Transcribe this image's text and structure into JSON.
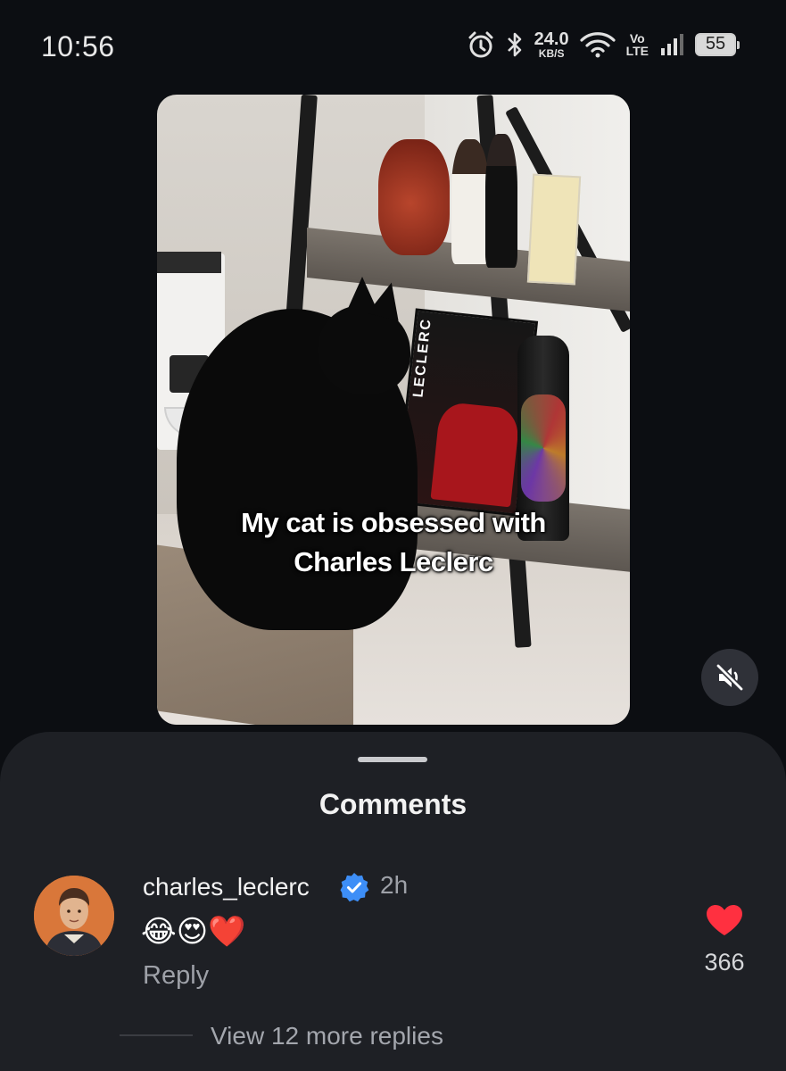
{
  "status_bar": {
    "time": "10:56",
    "net_speed_value": "24.0",
    "net_speed_unit": "KB/S",
    "volte_top": "Vo",
    "volte_bottom": "LTE",
    "battery": "55",
    "icons": [
      "alarm-icon",
      "bluetooth-icon",
      "wifi-icon",
      "signal-icon",
      "battery-icon"
    ]
  },
  "post": {
    "caption_line1": "My cat is obsessed with",
    "caption_line2": "Charles Leclerc",
    "poster_text": "LECLERC",
    "mute_icon": "volume-mute-icon"
  },
  "comments": {
    "title": "Comments",
    "items": [
      {
        "username": "charles_leclerc",
        "verified": true,
        "time": "2h",
        "text": "😂😍❤️",
        "reply_label": "Reply",
        "likes": "366",
        "view_replies": "View 12 more replies"
      }
    ]
  },
  "colors": {
    "background": "#0c0e12",
    "sheet": "#1e2025",
    "verified_blue": "#3d8ef7",
    "like_red": "#ff3040"
  }
}
